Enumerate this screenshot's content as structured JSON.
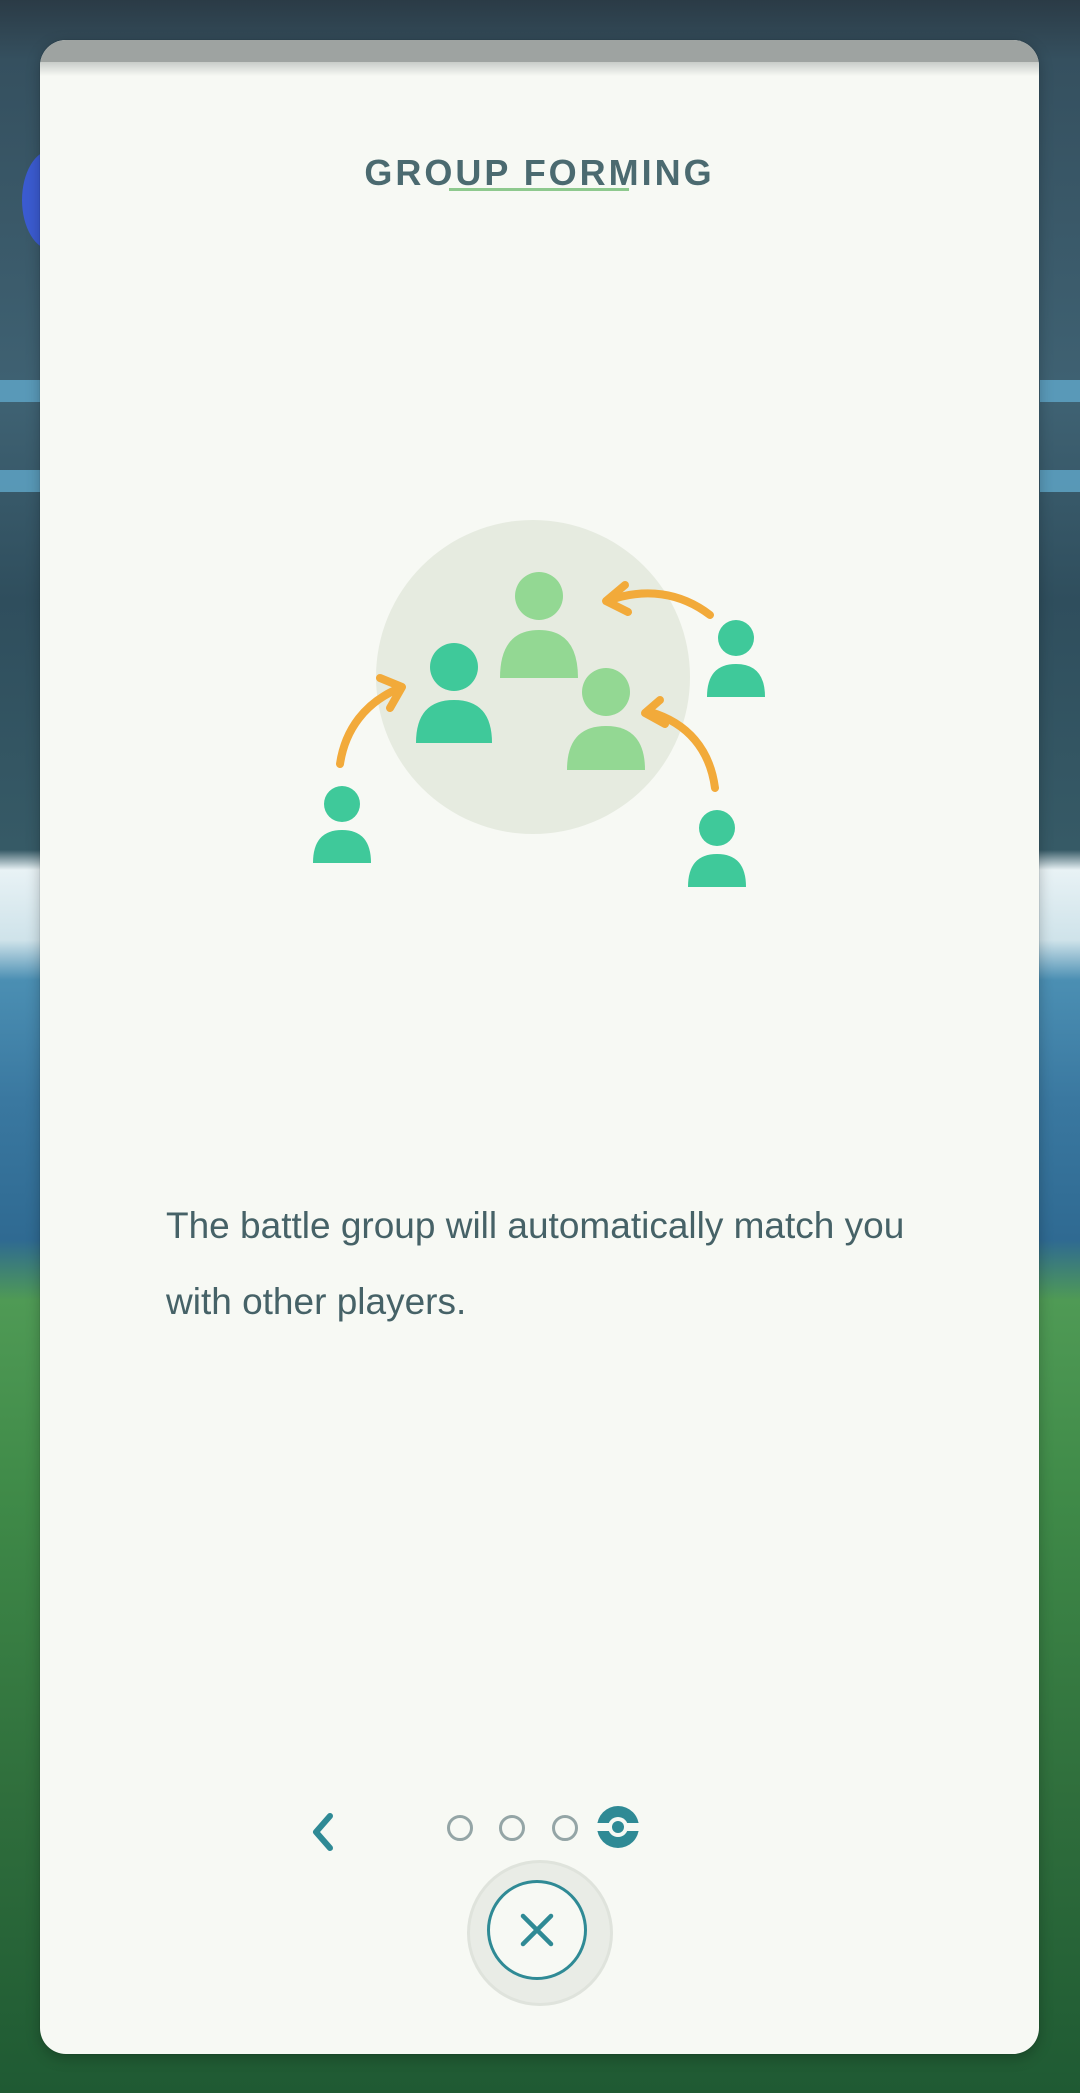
{
  "dialog": {
    "title": "GROUP FORMING",
    "description": "The battle group will automatically match you with other players."
  },
  "illustration": {
    "icon": "group-forming-players-icon",
    "colors": {
      "circle": "#e6ebe0",
      "player_dark": "#3fc99a",
      "player_light": "#93d893",
      "arrow": "#f2aa3a"
    }
  },
  "pager": {
    "total_pages": 4,
    "current_page": 4,
    "back_icon": "chevron-left-icon",
    "active_icon": "pokeball-icon"
  },
  "close": {
    "icon": "close-icon"
  },
  "colors": {
    "accent": "#2f8a95",
    "title": "#4b6a70",
    "text": "#466267",
    "card": "#f7f9f4"
  }
}
